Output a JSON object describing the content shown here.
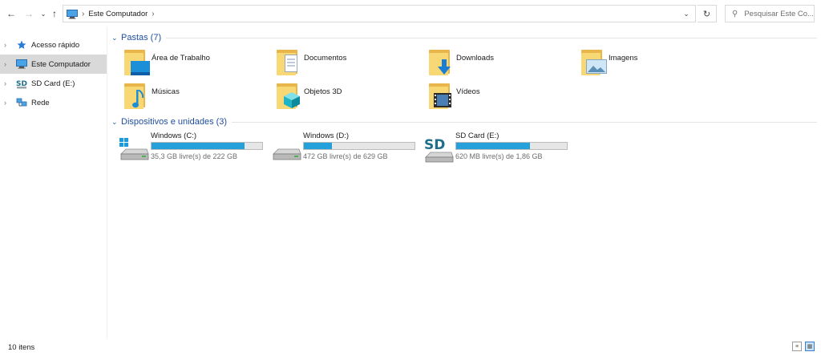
{
  "address": {
    "location": "Este Computador",
    "search_placeholder": "Pesquisar Este Co..."
  },
  "nav_pane": {
    "items": [
      {
        "label": "Acesso rápido"
      },
      {
        "label": "Este Computador"
      },
      {
        "label": "SD Card (E:)"
      },
      {
        "label": "Rede"
      }
    ]
  },
  "folders_group": {
    "title": "Pastas (7)",
    "items": [
      {
        "label": "Área de Trabalho",
        "icon": "desktop-folder-icon"
      },
      {
        "label": "Documentos",
        "icon": "documents-folder-icon"
      },
      {
        "label": "Downloads",
        "icon": "downloads-folder-icon"
      },
      {
        "label": "Imagens",
        "icon": "pictures-folder-icon"
      },
      {
        "label": "Músicas",
        "icon": "music-folder-icon"
      },
      {
        "label": "Objetos 3D",
        "icon": "3d-objects-folder-icon"
      },
      {
        "label": "Vídeos",
        "icon": "videos-folder-icon"
      }
    ]
  },
  "drives_group": {
    "title": "Dispositivos e unidades (3)",
    "items": [
      {
        "label": "Windows (C:)",
        "free": "35,3 GB livre(s) de 222 GB",
        "used_fraction": 0.84
      },
      {
        "label": "Windows (D:)",
        "free": "472 GB livre(s) de 629 GB",
        "used_fraction": 0.25
      },
      {
        "label": "SD Card (E:)",
        "free": "620 MB livre(s) de 1,86 GB",
        "used_fraction": 0.67,
        "icon_text": "SD"
      }
    ]
  },
  "status": {
    "item_count": "10 itens"
  },
  "colors": {
    "accent": "#26a0da",
    "group_title": "#1f4e9e",
    "folder": "#f8d775"
  }
}
